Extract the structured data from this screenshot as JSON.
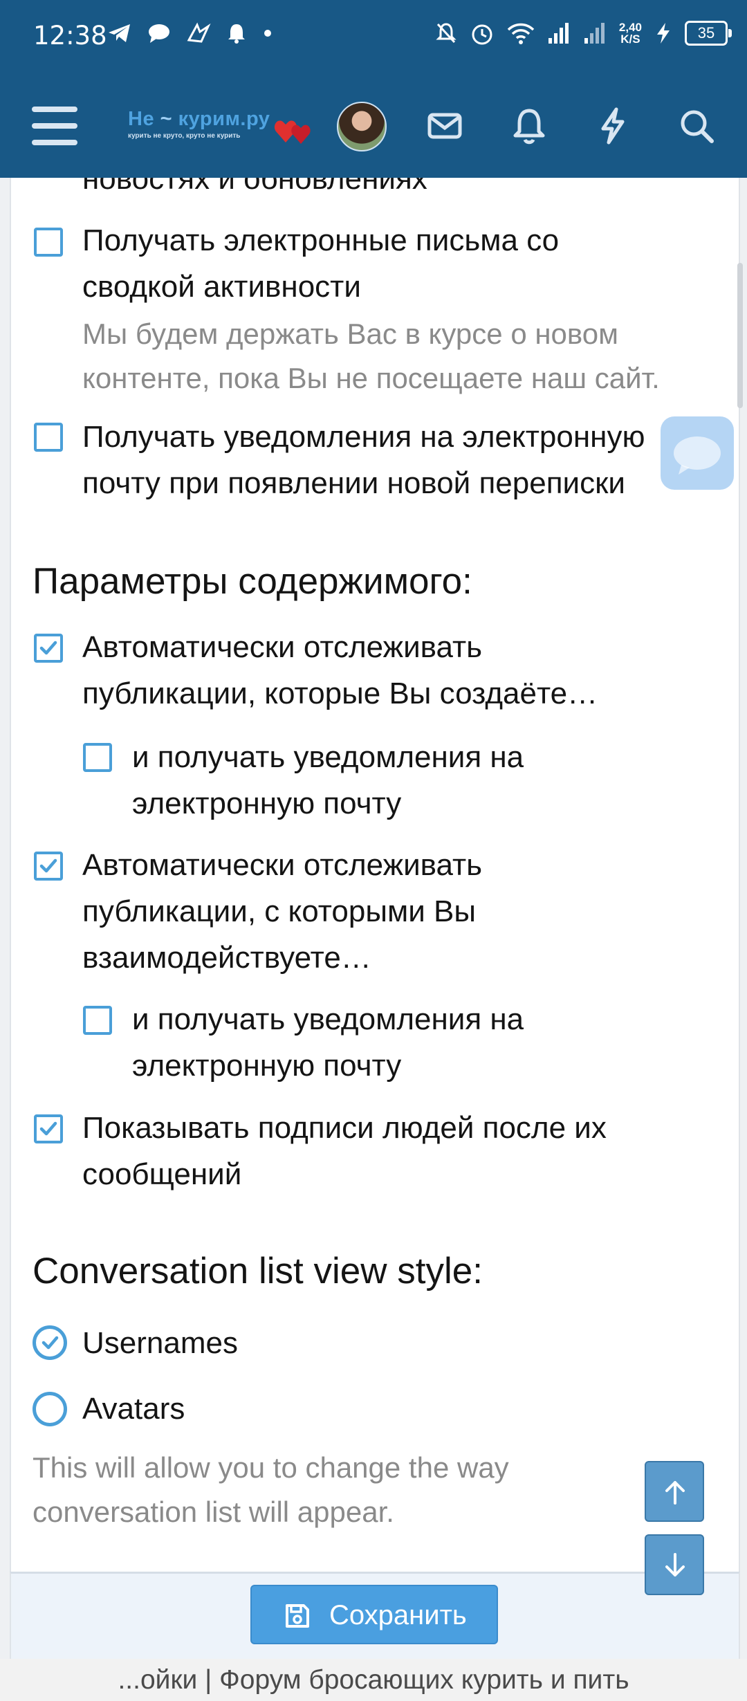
{
  "status_bar": {
    "time": "12:38",
    "net_speed_value": "2,40",
    "net_speed_unit": "K/S",
    "battery": "35"
  },
  "header": {
    "logo_brand_pre": "Не",
    "logo_brand_post": "курим.ру",
    "logo_tagline": "курить не круто, круто не курить",
    "menu_icon": "hamburger-menu-icon",
    "icons": [
      "mail-icon",
      "bell-icon",
      "lightning-icon",
      "search-icon"
    ],
    "accent_color": "#185886"
  },
  "email_options": {
    "cut_off_text": "новостях и обновлениях",
    "digest_line1": "Получать электронные письма со",
    "digest_line2": "сводкой активности",
    "digest_checked": false,
    "digest_hint_line1": "Мы будем держать Вас в курсе о новом",
    "digest_hint_line2": "контенте, пока Вы не посещаете наш сайт.",
    "conversation_line1": "Получать уведомления на электронную",
    "conversation_line2": "почту при появлении новой переписки",
    "conversation_checked": false
  },
  "content_options": {
    "title": "Параметры содержимого:",
    "watch_created_line1": "Автоматически отслеживать",
    "watch_created_line2": "публикации, которые Вы создаёте…",
    "watch_created_checked": true,
    "watch_created_email_line1": "и получать уведомления на",
    "watch_created_email_line2": "электронную почту",
    "watch_created_email_checked": false,
    "watch_interact_line1": "Автоматически отслеживать",
    "watch_interact_line2": "публикации, с которыми Вы",
    "watch_interact_line3": "взаимодействуете…",
    "watch_interact_checked": true,
    "watch_interact_email_line1": "и получать уведомления на",
    "watch_interact_email_line2": "электронную почту",
    "watch_interact_email_checked": false,
    "signatures_line1": "Показывать подписи людей после их",
    "signatures_line2": "сообщений",
    "signatures_checked": true
  },
  "conversation_view": {
    "title": "Conversation list view style:",
    "options": [
      {
        "label": "Usernames",
        "selected": true
      },
      {
        "label": "Avatars",
        "selected": false
      }
    ],
    "hint_line1": "This will allow you to change the way",
    "hint_line2": "conversation list will appear."
  },
  "footer": {
    "save_label": "Сохранить",
    "page_title": "...ойки | Форум бросающих курить и пить"
  }
}
